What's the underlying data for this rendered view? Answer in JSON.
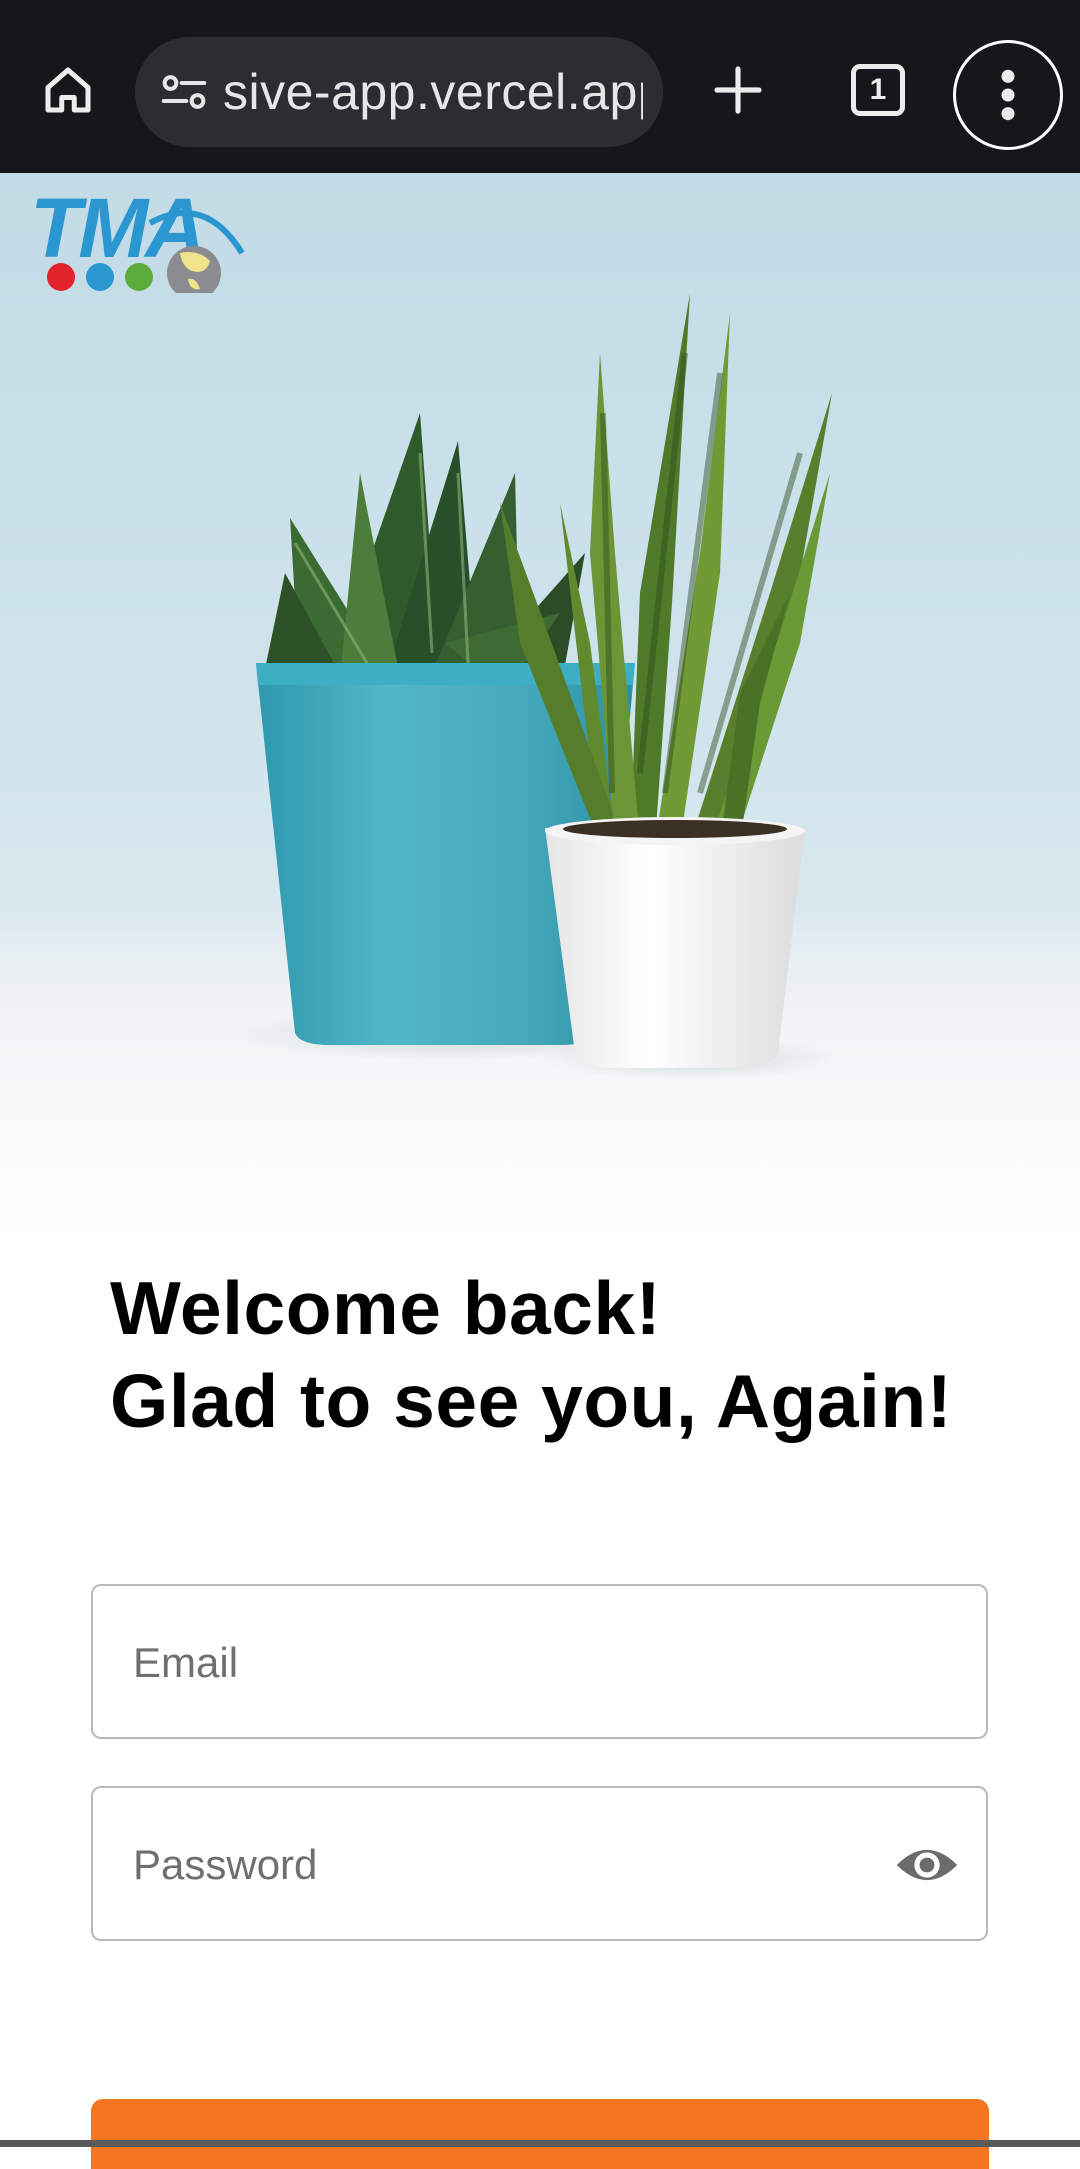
{
  "browser": {
    "url": "sive-app.vercel.app",
    "tab_count": "1"
  },
  "logo": {
    "text": "TMA"
  },
  "login": {
    "welcome_line1": "Welcome back!",
    "welcome_line2": "Glad to see you, Again!",
    "email_placeholder": "Email",
    "password_placeholder": "Password",
    "submit_color": "#f47620"
  },
  "icons": {
    "home": "home-icon",
    "site_info": "tune-icon",
    "new_tab": "plus-icon",
    "tabs": "tab-switcher-icon",
    "menu": "more-vert-icon",
    "password_visibility": "eye-icon"
  },
  "colors": {
    "browser_bar": "#16171b",
    "url_pill": "#2b2d33",
    "logo_blue": "#2b97d1",
    "accent_orange": "#f47620"
  }
}
